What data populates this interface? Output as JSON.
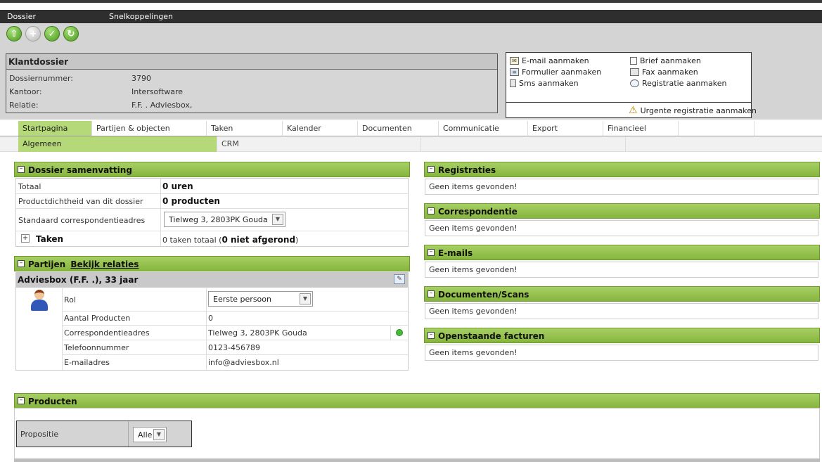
{
  "menubar": {
    "dossier": "Dossier",
    "snelkoppelingen": "Snelkoppelingen"
  },
  "toolbar": {
    "buttons": [
      "up-arrow-icon",
      "add-icon",
      "check-icon",
      "refresh-icon"
    ]
  },
  "klantdossier": {
    "title": "Klantdossier",
    "rows": [
      {
        "label": "Dossiernummer:",
        "value": "3790"
      },
      {
        "label": "Kantoor:",
        "value": "Intersoftware"
      },
      {
        "label": "Relatie:",
        "value": "F.F. . Adviesbox,"
      }
    ]
  },
  "actions": {
    "left": [
      "E-mail aanmaken",
      "Formulier aanmaken",
      "Sms aanmaken"
    ],
    "right": [
      "Brief aanmaken",
      "Fax aanmaken",
      "Registratie aanmaken"
    ],
    "urgent": "Urgente registratie aanmaken"
  },
  "tabs": [
    "Startpagina",
    "Partijen & objecten",
    "Taken",
    "Kalender",
    "Documenten",
    "Communicatie",
    "Export",
    "Financieel"
  ],
  "subtabs": [
    "Algemeen",
    "CRM"
  ],
  "samenvatting": {
    "title": "Dossier samenvatting",
    "totaal_label": "Totaal",
    "totaal_value": "0 uren",
    "product_label": "Productdichtheid van dit dossier",
    "product_value": "0 producten",
    "adres_label": "Standaard correspondentieadres",
    "adres_value": "Tielweg 3, 2803PK Gouda",
    "taken_label": "Taken",
    "taken_prefix": "0 taken totaal (",
    "taken_bold": "0 niet afgerond",
    "taken_suffix": ")"
  },
  "partijen": {
    "title": "Partijen",
    "link": "Bekijk relaties",
    "person_header": "Adviesbox (F.F. .), 33 jaar",
    "rows": [
      {
        "label": "Rol",
        "value": "Eerste persoon"
      },
      {
        "label": "Aantal Producten",
        "value": "0"
      },
      {
        "label": "Correspondentieadres",
        "value": "Tielweg 3, 2803PK Gouda"
      },
      {
        "label": "Telefoonnummer",
        "value": "0123-456789"
      },
      {
        "label": "E-mailadres",
        "value": "info@adviesbox.nl"
      }
    ]
  },
  "right_panels": [
    {
      "title": "Registraties",
      "content": "Geen items gevonden!"
    },
    {
      "title": "Correspondentie",
      "content": "Geen items gevonden!"
    },
    {
      "title": "E-mails",
      "content": "Geen items gevonden!"
    },
    {
      "title": "Documenten/Scans",
      "content": "Geen items gevonden!"
    },
    {
      "title": "Openstaande facturen",
      "content": "Geen items gevonden!"
    }
  ],
  "producten": {
    "title": "Producten",
    "filter_label": "Propositie",
    "filter_value": "Alle"
  },
  "colors": {
    "accent_green": "#9bc455",
    "active_tab": "#b5d878"
  }
}
